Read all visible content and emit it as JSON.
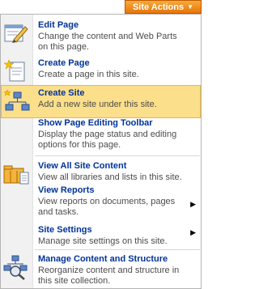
{
  "header": {
    "site_actions_label": "Site Actions",
    "chevron_icon": "chevron-down-icon"
  },
  "menu": {
    "items": [
      {
        "title": "Edit Page",
        "description": "Change the content and Web Parts on this page.",
        "icon": "edit-page-icon"
      },
      {
        "title": "Create Page",
        "description": "Create a page in this site.",
        "icon": "create-page-icon"
      },
      {
        "title": "Create Site",
        "description": "Add a new site under this site.",
        "icon": "create-site-icon",
        "highlighted": true
      },
      {
        "title": "Show Page Editing Toolbar",
        "description": "Display the page status and editing options for this page.",
        "icon": "toolbar-icon"
      },
      {
        "title": "View All Site Content",
        "description": "View all libraries and lists in this site.",
        "icon": "site-content-icon"
      },
      {
        "title": "View Reports",
        "description": "View reports on documents, pages and tasks.",
        "icon": "reports-icon",
        "submenu": true
      },
      {
        "title": "Site Settings",
        "description": "Manage site settings on this site.",
        "icon": "settings-icon",
        "submenu": true
      },
      {
        "title": "Manage Content and Structure",
        "description": "Reorganize content and structure in this site collection.",
        "icon": "manage-content-icon"
      }
    ]
  },
  "colors": {
    "accent_orange": "#e8760a",
    "highlight": "#fcdf8a",
    "title_blue": "#003399",
    "description_gray": "#4c4c4c"
  }
}
